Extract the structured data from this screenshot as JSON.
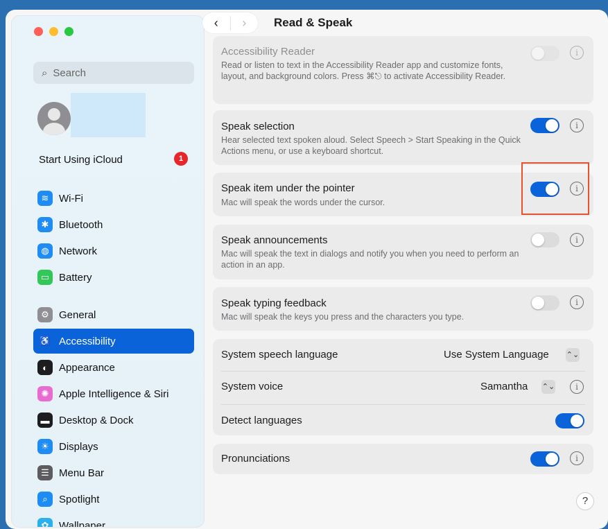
{
  "sidebar": {
    "search_placeholder": "Search",
    "icloud_label": "Start Using iCloud",
    "icloud_badge": "1",
    "items": [
      {
        "label": "Wi-Fi",
        "icon": "wifi-icon",
        "color": "#1e8cf3"
      },
      {
        "label": "Bluetooth",
        "icon": "bluetooth-icon",
        "color": "#1e8cf3"
      },
      {
        "label": "Network",
        "icon": "globe-icon",
        "color": "#1e8cf3"
      },
      {
        "label": "Battery",
        "icon": "battery-icon",
        "color": "#33c759"
      },
      {
        "label": "General",
        "icon": "gear-icon",
        "color": "#8e8e93"
      },
      {
        "label": "Accessibility",
        "icon": "accessibility-icon",
        "color": "#0a63d8"
      },
      {
        "label": "Appearance",
        "icon": "appearance-icon",
        "color": "#1d1d1f"
      },
      {
        "label": "Apple Intelligence & Siri",
        "icon": "siri-icon",
        "color": "#e86bd0"
      },
      {
        "label": "Desktop & Dock",
        "icon": "dock-icon",
        "color": "#1d1d1f"
      },
      {
        "label": "Displays",
        "icon": "displays-icon",
        "color": "#1e8cf3"
      },
      {
        "label": "Menu Bar",
        "icon": "menubar-icon",
        "color": "#5c5c60"
      },
      {
        "label": "Spotlight",
        "icon": "spotlight-icon",
        "color": "#1e8cf3"
      },
      {
        "label": "Wallpaper",
        "icon": "wallpaper-icon",
        "color": "#2ab0ea"
      }
    ],
    "active_item": "Accessibility"
  },
  "header": {
    "title": "Read & Speak",
    "back": "‹",
    "forward": "›"
  },
  "settings": {
    "reader": {
      "title": "Accessibility Reader",
      "desc": "Read or listen to text in the Accessibility Reader app and customize fonts, layout, and background colors. Press ⌘⎋ to activate Accessibility Reader.",
      "on": false
    },
    "speak_selection": {
      "title": "Speak selection",
      "desc": "Hear selected text spoken aloud. Select Speech > Start Speaking in the Quick Actions menu, or use a keyboard shortcut.",
      "on": true
    },
    "speak_pointer": {
      "title": "Speak item under the pointer",
      "desc": "Mac will speak the words under the cursor.",
      "on": true
    },
    "announcements": {
      "title": "Speak announcements",
      "desc": "Mac will speak the text in dialogs and notify you when you need to perform an action in an app.",
      "on": false
    },
    "typing": {
      "title": "Speak typing feedback",
      "desc": "Mac will speak the keys you press and the characters you type.",
      "on": false
    },
    "speech_language": {
      "label": "System speech language",
      "value": "Use System Language"
    },
    "system_voice": {
      "label": "System voice",
      "value": "Samantha"
    },
    "detect_languages": {
      "label": "Detect languages",
      "on": true
    },
    "pronunciations": {
      "label": "Pronunciations",
      "on": true
    }
  },
  "help_label": "?",
  "info_glyph": "i",
  "stepper_glyph": "⌃⌄",
  "accent_color": "#0a63d8"
}
